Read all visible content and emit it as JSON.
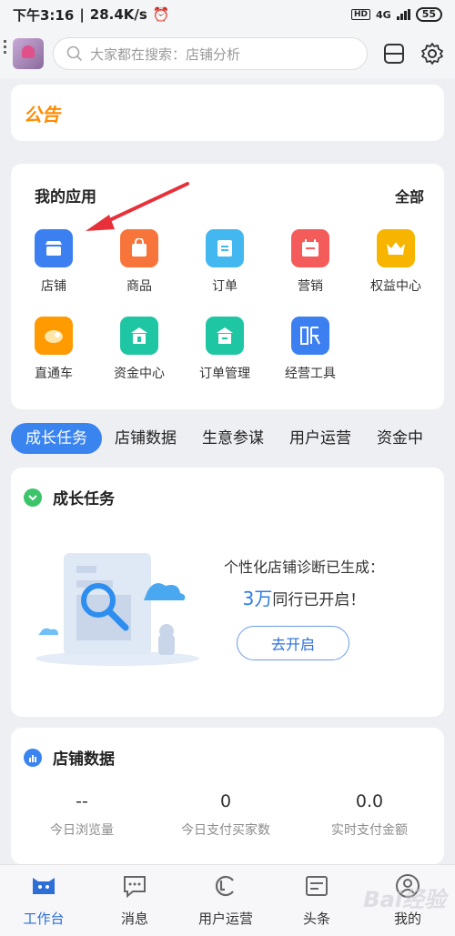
{
  "status": {
    "time": "下午3:16",
    "speed": "28.4K/s",
    "net": "4G",
    "hd": "HD",
    "battery": "55"
  },
  "search": {
    "placeholder": "大家都在搜索：店铺分析"
  },
  "notice": {
    "title": "公告"
  },
  "apps": {
    "title": "我的应用",
    "all": "全部",
    "items": [
      {
        "label": "店铺",
        "icon": "store-icon",
        "color": "#3c7ff0"
      },
      {
        "label": "商品",
        "icon": "bag-icon",
        "color": "#f7743a"
      },
      {
        "label": "订单",
        "icon": "order-icon",
        "color": "#42b7f0"
      },
      {
        "label": "营销",
        "icon": "calendar-icon",
        "color": "#f45c5c"
      },
      {
        "label": "权益中心",
        "icon": "crown-icon",
        "color": "#f7b500"
      },
      {
        "label": "直通车",
        "icon": "car-icon",
        "color": "#ff9a00"
      },
      {
        "label": "资金中心",
        "icon": "funds-icon",
        "color": "#1fc6a4"
      },
      {
        "label": "订单管理",
        "icon": "order-manage-icon",
        "color": "#1fc6a4"
      },
      {
        "label": "经营工具",
        "icon": "tools-icon",
        "color": "#3c7ff0"
      }
    ]
  },
  "tabs": [
    "成长任务",
    "店铺数据",
    "生意参谋",
    "用户运营",
    "资金中"
  ],
  "growth": {
    "title": "成长任务",
    "line1": "个性化店铺诊断已生成：",
    "count": "3万",
    "line2": "同行已开启！",
    "button": "去开启"
  },
  "shopdata": {
    "title": "店铺数据",
    "stats": [
      {
        "value": "--",
        "label": "今日浏览量"
      },
      {
        "value": "0",
        "label": "今日支付买家数"
      },
      {
        "value": "0.0",
        "label": "实时支付金额"
      }
    ]
  },
  "nav": [
    {
      "label": "工作台",
      "icon": "workbench-icon"
    },
    {
      "label": "消息",
      "icon": "message-icon"
    },
    {
      "label": "用户运营",
      "icon": "user-ops-icon"
    },
    {
      "label": "头条",
      "icon": "headline-icon"
    },
    {
      "label": "我的",
      "icon": "profile-icon"
    }
  ],
  "watermark": "Bai经验",
  "colors": {
    "accent": "#3a84f0",
    "notice": "#ff8c00",
    "arrow": "#e8303a"
  }
}
